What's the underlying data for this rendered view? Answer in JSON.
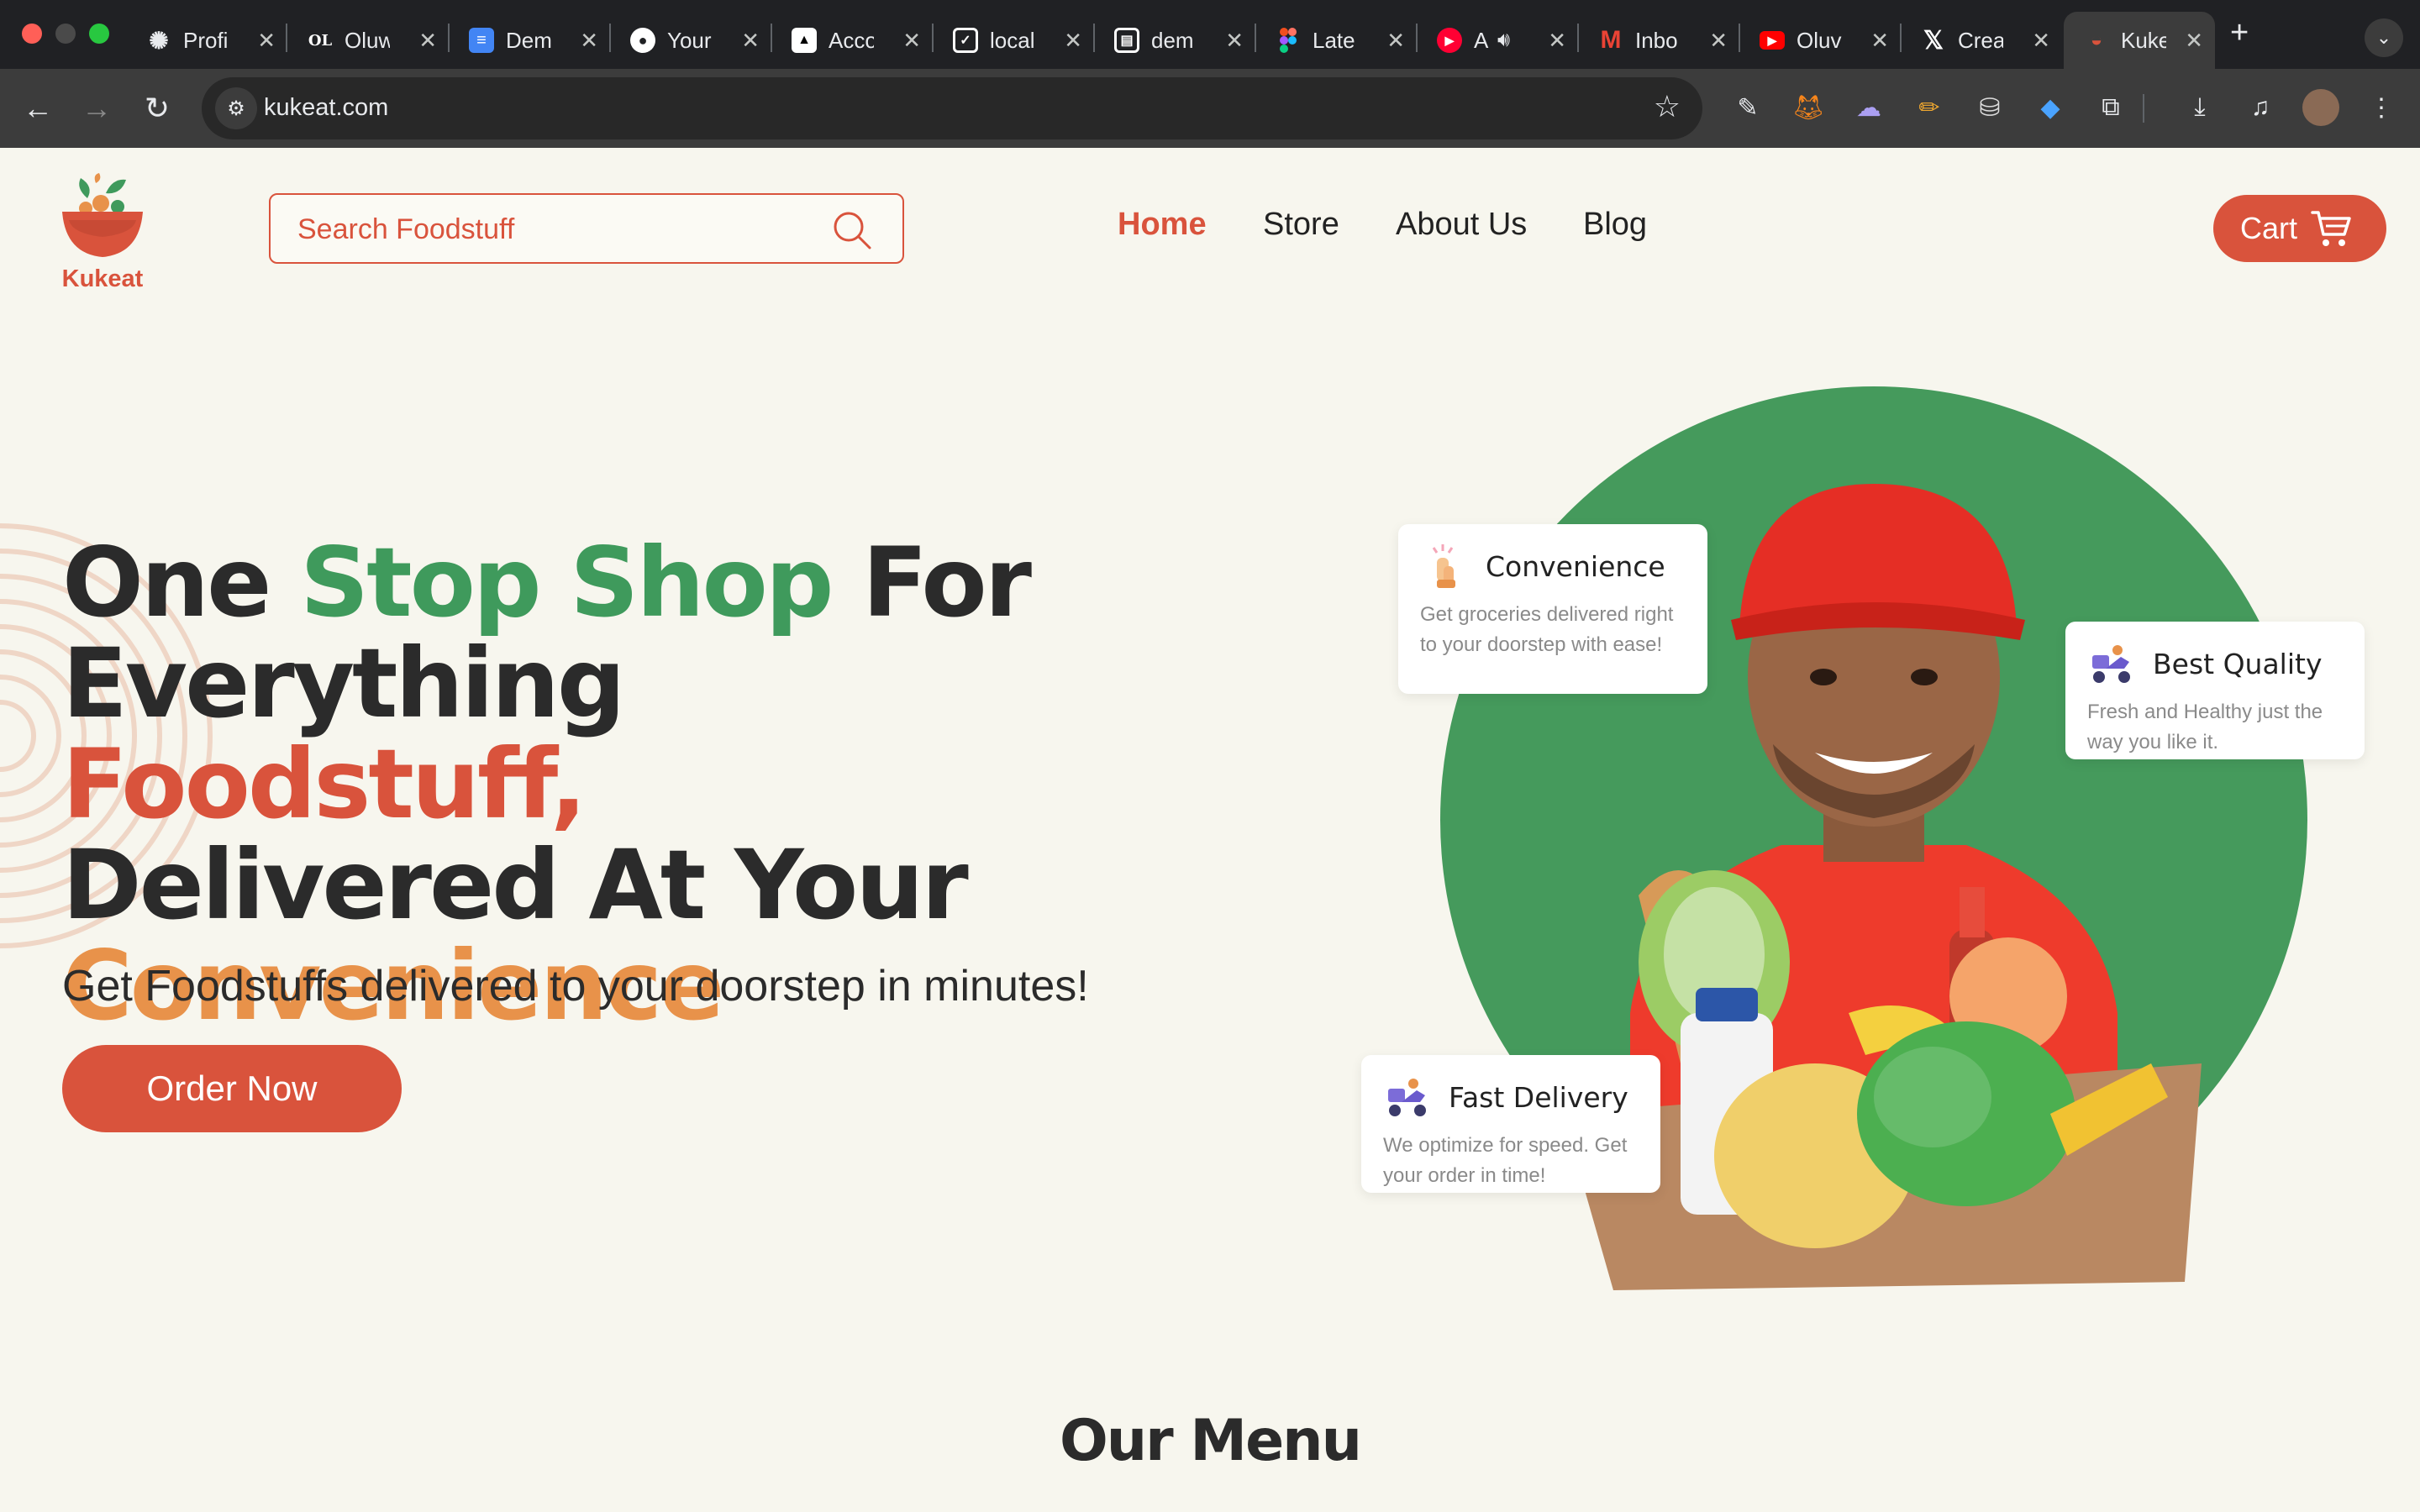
{
  "browser": {
    "tabs": [
      {
        "title": "Profi",
        "icon": "chatgpt-icon"
      },
      {
        "title": "Oluw",
        "icon": "openlibrary-icon"
      },
      {
        "title": "Dem",
        "icon": "google-docs-icon"
      },
      {
        "title": "Your",
        "icon": "github-icon"
      },
      {
        "title": "Acco",
        "icon": "vercel-icon"
      },
      {
        "title": "local",
        "icon": "localhost-icon"
      },
      {
        "title": "dem",
        "icon": "document-icon"
      },
      {
        "title": "Late",
        "icon": "figma-icon"
      },
      {
        "title": "A",
        "icon": "youtube-music-icon"
      },
      {
        "title": "Inbo",
        "icon": "gmail-icon"
      },
      {
        "title": "Oluv",
        "icon": "youtube-icon"
      },
      {
        "title": "Crea",
        "icon": "x-icon"
      },
      {
        "title": "Kuke",
        "icon": "kukeat-icon"
      }
    ],
    "url": "kukeat.com"
  },
  "site": {
    "logo_text": "Kukeat",
    "search_placeholder": "Search Foodstuff",
    "nav": {
      "home": "Home",
      "store": "Store",
      "about": "About Us",
      "blog": "Blog"
    },
    "cart_label": "Cart"
  },
  "hero": {
    "line1_a": "One ",
    "line1_b": "Stop Shop",
    "line1_c": " For",
    "line2_a": "Everything ",
    "line2_b": "Foodstuff,",
    "line3": "Delivered At Your",
    "line4": "Convenience",
    "subtitle": "Get Foodstuffs delivered to your doorstep in minutes!",
    "cta": "Order Now"
  },
  "features": {
    "convenience": {
      "title": "Convenience",
      "desc": "Get groceries delivered right to your doorstep with ease!",
      "icon": "pointing-hand-icon"
    },
    "quality": {
      "title": "Best Quality",
      "desc": "Fresh and Healthy just the way you like it.",
      "icon": "delivery-scooter-icon"
    },
    "delivery": {
      "title": "Fast Delivery",
      "desc": "We optimize for speed. Get your order in time!",
      "icon": "delivery-scooter-icon"
    }
  },
  "menu_section": {
    "title": "Our Menu"
  },
  "colors": {
    "brand_red": "#d9533c",
    "brand_green": "#3f9a5c",
    "brand_orange": "#e8924a",
    "background": "#f7f6ee"
  }
}
